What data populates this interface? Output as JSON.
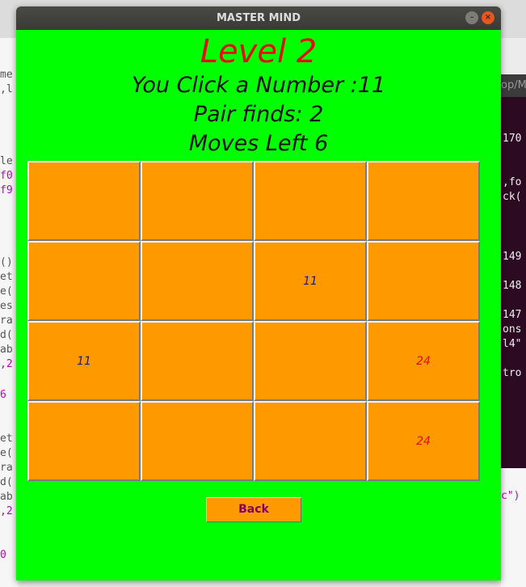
{
  "window": {
    "title": "MASTER MIND"
  },
  "game": {
    "level": "Level 2",
    "clicked": "You Click a Number :11",
    "pairs": "Pair finds: 2",
    "moves": "Moves Left 6"
  },
  "grid": {
    "rows": [
      [
        "",
        "",
        "",
        ""
      ],
      [
        "",
        "",
        "11",
        ""
      ],
      [
        "11",
        "",
        "",
        "24"
      ],
      [
        "",
        "",
        "",
        "24"
      ]
    ],
    "colors": {
      "matched_blue": "#1a1a80",
      "revealed_red": "#e01010",
      "card": "#ff9900",
      "board": "#00ff00"
    }
  },
  "buttons": {
    "back": "Back"
  },
  "background": {
    "editor_left": [
      "me",
      ",l",
      "le",
      "f0",
      "f9",
      "()",
      "et",
      "e(",
      "es",
      "ra",
      "d(",
      "ab",
      ",2",
      "6",
      "et",
      "e(",
      "ra",
      "d(",
      "ab",
      ",2",
      "0"
    ],
    "terminal_head": "op/M",
    "terminal": [
      "170",
      ",fo",
      "ck(",
      "149",
      "148",
      "147",
      "ons",
      "l4\"",
      "tro"
    ],
    "right_lower": "c\")"
  }
}
